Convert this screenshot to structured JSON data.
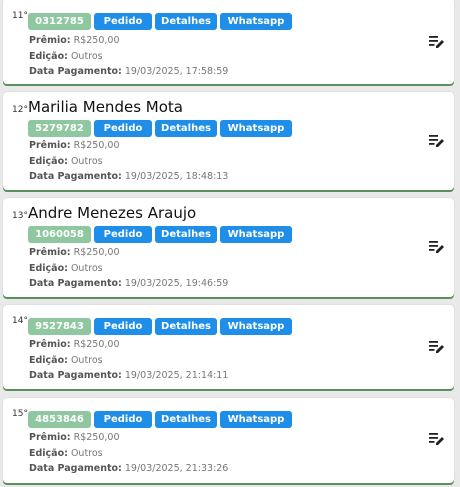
{
  "labels": {
    "premio": "Prêmio:",
    "edicao": "Edição:",
    "data_pagamento": "Data Pagamento:"
  },
  "buttons": {
    "pedido": "Pedido",
    "detalhes": "Detalhes",
    "whatsapp": "Whatsapp"
  },
  "cards": [
    {
      "rank": "11°",
      "name": "",
      "id": "0312785",
      "premio": "R$250,00",
      "edicao": "Outros",
      "data_pagamento": "19/03/2025, 17:58:59"
    },
    {
      "rank": "12°",
      "name": "Marilia Mendes Mota",
      "id": "5279782",
      "premio": "R$250,00",
      "edicao": "Outros",
      "data_pagamento": "19/03/2025, 18:48:13"
    },
    {
      "rank": "13°",
      "name": "Andre Menezes Araujo",
      "id": "1060058",
      "premio": "R$250,00",
      "edicao": "Outros",
      "data_pagamento": "19/03/2025, 19:46:59"
    },
    {
      "rank": "14°",
      "name": "",
      "id": "9527843",
      "premio": "R$250,00",
      "edicao": "Outros",
      "data_pagamento": "19/03/2025, 21:14:11"
    },
    {
      "rank": "15°",
      "name": "",
      "id": "4853846",
      "premio": "R$250,00",
      "edicao": "Outros",
      "data_pagamento": "19/03/2025, 21:33:26"
    }
  ],
  "icons": {
    "edit": "edit-note-icon"
  },
  "colors": {
    "id_badge": "#8fc8a0",
    "button_blue": "#1f8ee8",
    "card_shadow": "#5a8f5e"
  }
}
